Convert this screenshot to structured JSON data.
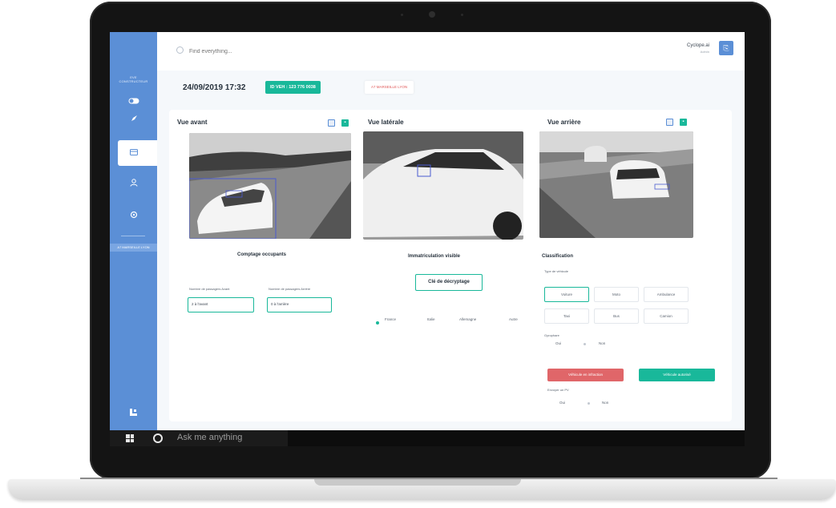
{
  "topbar": {
    "search_placeholder": "Find everything...",
    "user_name": "Cyclope.ai",
    "user_role": "Admin"
  },
  "sidebar": {
    "top_label_line1": "EVE",
    "top_label_line2": "CONSTRUCTEUR",
    "zone_tag": "A7 MARSEILLE LYON",
    "items": [
      {
        "icon": "toggle-icon"
      },
      {
        "icon": "rocket-icon"
      },
      {
        "icon": "card-icon",
        "active": true
      },
      {
        "icon": "user-icon"
      },
      {
        "icon": "settings-icon"
      }
    ]
  },
  "info": {
    "datetime": "24/09/2019 17:32",
    "vehicle_id": "ID VEH : 123 776 0038",
    "location": "A7 MARSEILLE LYON"
  },
  "views": {
    "front": "Vue avant",
    "side": "Vue latérale",
    "rear": "Vue arrière"
  },
  "occupants": {
    "title": "Comptage occupants",
    "front_label": "Nombre de passagers Avant",
    "rear_label": "Nombre de passagers Arrière",
    "front_value": "2 à l'avant",
    "rear_value": "0 à l'arrière"
  },
  "plate": {
    "title": "Immatriculation visible",
    "key_button": "Clé de décryptage",
    "countries": [
      "France",
      "Italie",
      "Allemagne",
      "Autre"
    ],
    "selected_country": "France"
  },
  "classification": {
    "title": "Classification",
    "type_label": "Type de véhicule",
    "types": [
      "Voiture",
      "Moto",
      "Ambulance",
      "Taxi",
      "Bus",
      "Camion"
    ],
    "selected_type": "Voiture",
    "gyro_label": "Gyrophare",
    "gyro_options": [
      "Oui",
      "Non"
    ],
    "btn_infraction": "Véhicule en infraction",
    "btn_normal": "Véhicule autorisé",
    "pv_label": "Envoyer un PV",
    "pv_options": [
      "Oui",
      "Non"
    ]
  },
  "taskbar": {
    "search_text": "Ask me anything"
  },
  "colors": {
    "sidebar": "#5b8fd6",
    "accent_green": "#19b89a",
    "accent_red": "#e06669"
  }
}
